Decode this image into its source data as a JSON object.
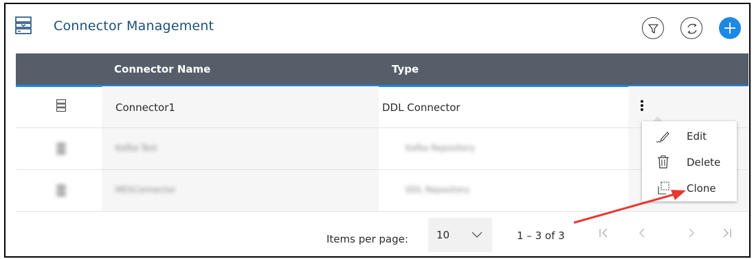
{
  "header": {
    "title": "Connector Management",
    "icons": [
      "connector-icon",
      "filter-icon",
      "refresh-icon",
      "add-icon"
    ],
    "accent_color": "#1e88e5"
  },
  "table": {
    "columns": [
      "Connector Name",
      "Type"
    ],
    "rows": [
      {
        "name": "Connector1",
        "type": "DDL Connector",
        "blurred": false
      },
      {
        "name": "Kafka Test",
        "type": "Kafka Repository",
        "blurred": true
      },
      {
        "name": "MESConnector",
        "type": "DDL Repository",
        "blurred": true
      }
    ],
    "header_color": "#555e69"
  },
  "context_menu": {
    "items": [
      {
        "label": "Edit",
        "icon": "pencil-icon"
      },
      {
        "label": "Delete",
        "icon": "trash-icon"
      },
      {
        "label": "Clone",
        "icon": "clone-icon"
      }
    ]
  },
  "paginator": {
    "items_per_page_label": "Items per page:",
    "page_size": "10",
    "range_label": "1 – 3 of 3",
    "buttons": [
      "first-page-icon",
      "previous-page-icon",
      "next-page-icon",
      "last-page-icon"
    ]
  },
  "annotation": {
    "arrow_color": "#e8372f"
  }
}
